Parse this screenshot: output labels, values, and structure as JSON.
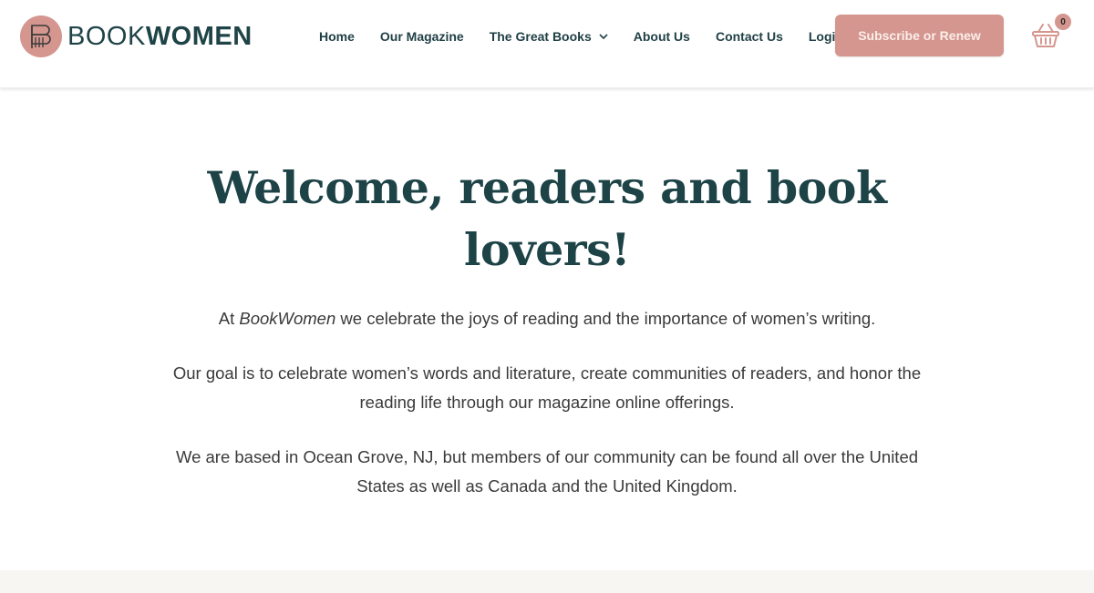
{
  "brand": {
    "name_light": "BOOK",
    "name_bold": "WOMEN",
    "accent_color": "#d4968f",
    "text_color": "#1f4448"
  },
  "nav": {
    "items": [
      {
        "label": "Home"
      },
      {
        "label": "Our Magazine"
      },
      {
        "label": "The Great Books",
        "has_dropdown": true
      },
      {
        "label": "About Us"
      },
      {
        "label": "Contact Us"
      },
      {
        "label": "Login"
      }
    ]
  },
  "header": {
    "subscribe_label": "Subscribe or Renew",
    "cart_icon": "basket-icon",
    "cart_count": "0"
  },
  "hero": {
    "title": "Welcome, readers and book lovers!",
    "intro_prefix": "At ",
    "intro_brand": "BookWomen",
    "intro_suffix": " we celebrate the joys of reading and the importance of women’s writing.",
    "goal": "Our goal is to celebrate women’s words and literature, create communities of readers, and honor the reading life through our magazine online offerings.",
    "location": "We are based in Ocean Grove, NJ, but members of our community can be found all over the United States as well as Canada and the United Kingdom."
  }
}
